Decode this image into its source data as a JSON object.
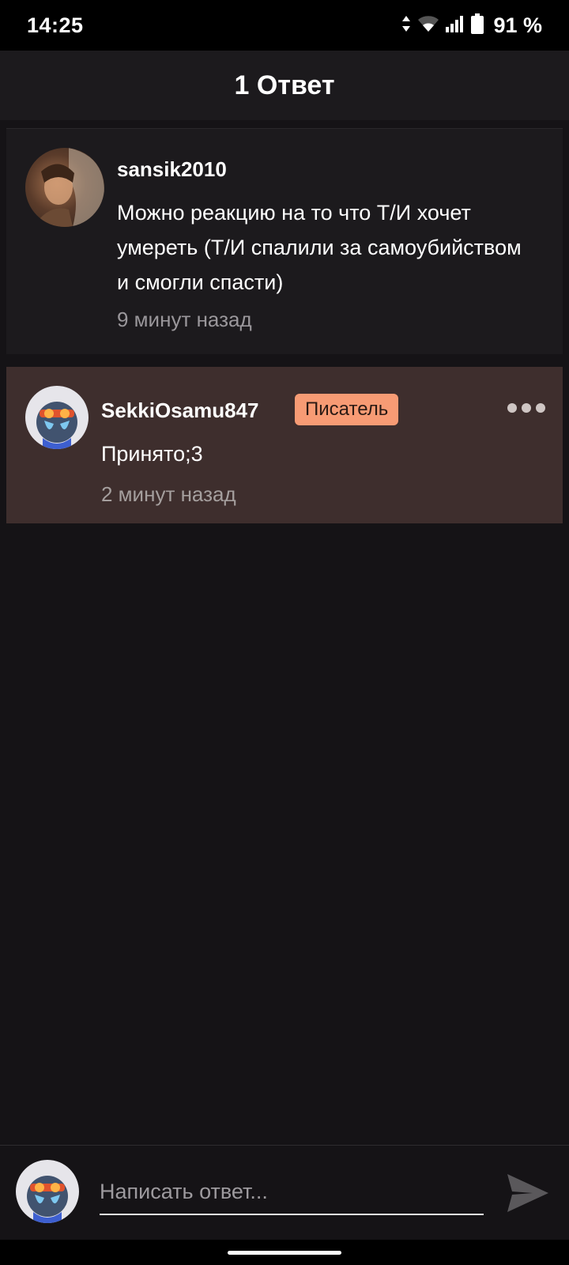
{
  "status_bar": {
    "time": "14:25",
    "battery_text": "91 %",
    "icons": [
      "data-arrows-icon",
      "wifi-icon",
      "signal-icon",
      "battery-icon"
    ]
  },
  "header": {
    "title": "1 Ответ"
  },
  "parent_comment": {
    "username": "sansik2010",
    "text": "Можно реакцию на то что Т/И хочет умереть (Т/И спалили за самоубийством и смогли спасти)",
    "timestamp": "9 минут назад"
  },
  "reply_comment": {
    "username": "SekkiOsamu847",
    "badge": "Писатель",
    "text": "Принято;3",
    "timestamp": "2 минут назад",
    "more_icon": "more-horizontal-icon"
  },
  "compose": {
    "placeholder": "Написать ответ...",
    "send_icon": "send-icon"
  },
  "colors": {
    "background": "#151316",
    "header_bg": "#1c1a1d",
    "reply_bg": "#3e2e2d",
    "badge_bg": "#f79b74",
    "muted_text": "#9a979b"
  }
}
